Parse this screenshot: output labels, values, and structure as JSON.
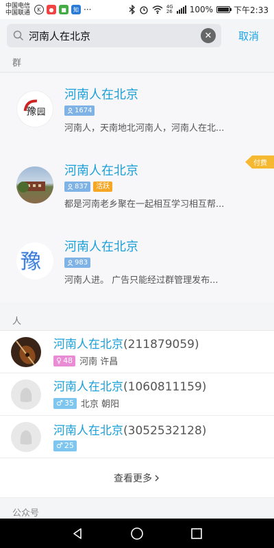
{
  "status_bar": {
    "carrier1": "中国电信",
    "carrier2": "中国联通",
    "battery": "100%",
    "time": "下午2:33",
    "network_tag1": "4G",
    "network_tag2": "26",
    "icons": [
      "k-app-icon",
      "maps-icon",
      "photo-app-icon",
      "zhihu-icon",
      "more-dots-icon",
      "bluetooth-icon",
      "alarm-icon",
      "wifi-icon",
      "signal-icon",
      "battery-icon"
    ]
  },
  "search": {
    "query": "河南人在北京",
    "cancel_label": "取消"
  },
  "sections": {
    "groups": "群",
    "people": "人",
    "public": "公众号"
  },
  "groups": [
    {
      "name": "河南人在北京",
      "members": "1674",
      "active": "",
      "desc": "河南人，天南地北河南人，河南人在北...",
      "paid": ""
    },
    {
      "name": "河南人在北京",
      "members": "837",
      "active": "活跃",
      "desc": "都是河南老乡聚在一起相互学习相互帮...",
      "paid": "付费"
    },
    {
      "name": "河南人在北京",
      "members": "983",
      "active": "",
      "desc": "河南人进。 广告只能经过群管理发布...",
      "paid": ""
    }
  ],
  "people": [
    {
      "name": "河南人在北京",
      "id": "(211879059)",
      "age": "48",
      "gender": "female",
      "location": "河南 许昌"
    },
    {
      "name": "河南人在北京",
      "id": "(1060811159)",
      "age": "35",
      "gender": "male",
      "location": "北京 朝阳"
    },
    {
      "name": "河南人在北京",
      "id": "(3052532128)",
      "age": "25",
      "gender": "male",
      "location": ""
    }
  ],
  "more_label": "查看更多",
  "colors": {
    "accent": "#1a9fd8",
    "paid": "#f6b731",
    "active": "#f5a623"
  }
}
